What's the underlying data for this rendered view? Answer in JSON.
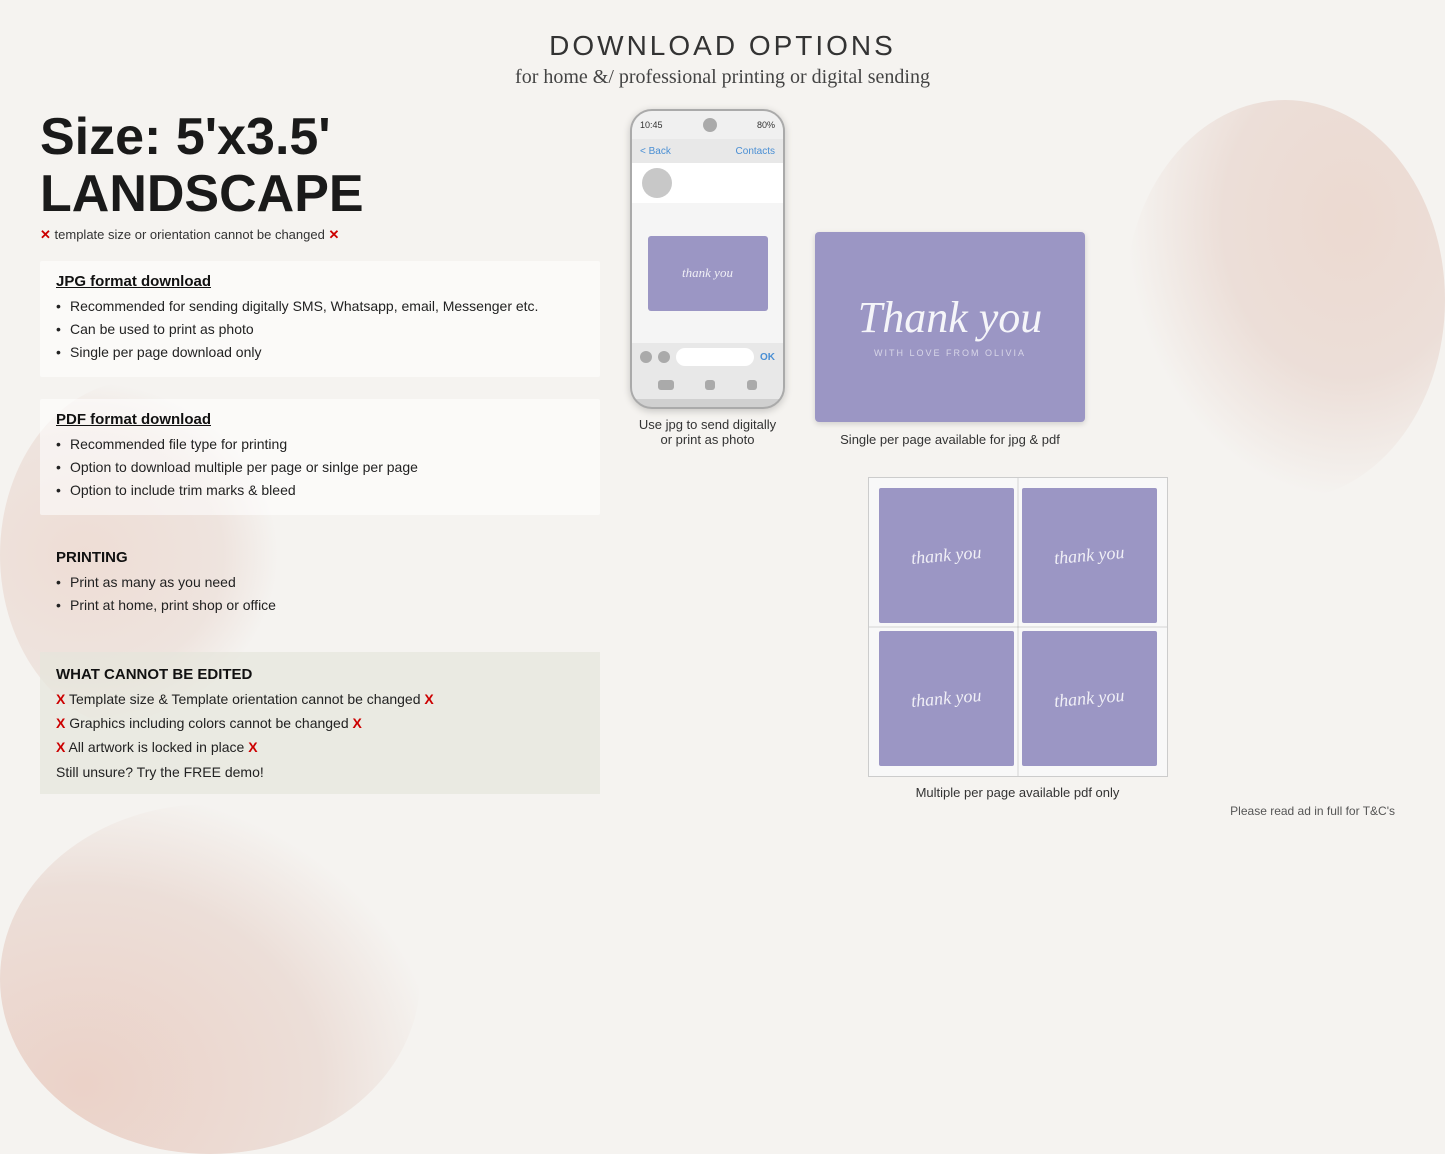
{
  "header": {
    "title": "DOWNLOAD OPTIONS",
    "subtitle": "for home &/ professional printing or digital sending"
  },
  "size_section": {
    "heading": "Size: 5'x3.5' LANDSCAPE",
    "cannot_change": "template size or orientation cannot be changed"
  },
  "jpg_section": {
    "title": "JPG format download",
    "bullets": [
      "Recommended for sending digitally SMS, Whatsapp, email, Messenger etc.",
      "Can be used to print as photo",
      "Single per page download only"
    ]
  },
  "pdf_section": {
    "title": "PDF format download",
    "bullets": [
      "Recommended file type for printing",
      "Option to download multiple per page or sinlge per page",
      "Option to include trim marks & bleed"
    ]
  },
  "printing_section": {
    "title": "PRINTING",
    "bullets": [
      "Print as many as you need",
      "Print at home, print shop or office"
    ]
  },
  "cannot_edit_section": {
    "title": "WHAT CANNOT BE EDITED",
    "items": [
      "Template size & Template orientation cannot be changed",
      "Graphics including colors cannot be changed",
      "All artwork is locked in place"
    ],
    "free_demo": "Still unsure? Try the FREE demo!"
  },
  "phone_mockup": {
    "time": "10:45",
    "battery": "80%",
    "back_label": "< Back",
    "contacts_label": "Contacts",
    "card_text": "thank you",
    "ok_label": "OK",
    "caption_line1": "Use jpg to send digitally",
    "caption_line2": "or print as photo"
  },
  "single_card": {
    "thank_text": "Thank you",
    "subtitle": "WITH LOVE FROM OLIVIA",
    "caption": "Single per page available for jpg & pdf"
  },
  "multi_cards": {
    "card_text": "thank you",
    "caption": "Multiple per page available pdf only"
  },
  "tc_note": "Please read ad in full for T&C's",
  "colors": {
    "card_background": "#9b96c4",
    "card_text": "rgba(255,255,255,0.85)",
    "x_mark": "#cc0000",
    "section_bg": "rgba(255,255,255,0.55)"
  }
}
